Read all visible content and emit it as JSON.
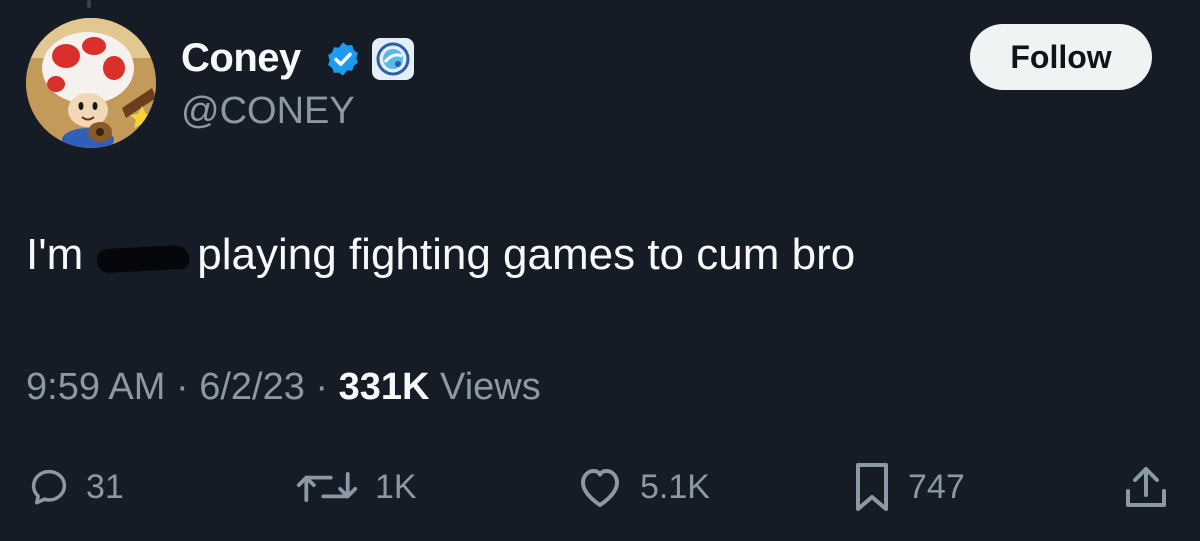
{
  "author": {
    "name": "Coney",
    "handle": "@CONEY",
    "avatar_icon": "toad-character-avatar",
    "verified_icon": "verified-badge-icon",
    "affiliate_icon": "affiliate-logo-badge"
  },
  "follow_button": {
    "label": "Follow"
  },
  "tweet": {
    "text_before": "I'm",
    "text_after": "playing fighting games to cum bro"
  },
  "meta": {
    "time": "9:59 AM",
    "separator": "·",
    "date": "6/2/23",
    "views_count": "331K",
    "views_label": "Views"
  },
  "actions": {
    "replies": "31",
    "reposts": "1K",
    "likes": "5.1K",
    "bookmarks": "747"
  },
  "colors": {
    "background": "#161c25",
    "text_primary": "#f7f9f9",
    "text_secondary": "#8b98a5",
    "verified_blue": "#1d9bf0",
    "follow_bg": "#eff3f4"
  }
}
